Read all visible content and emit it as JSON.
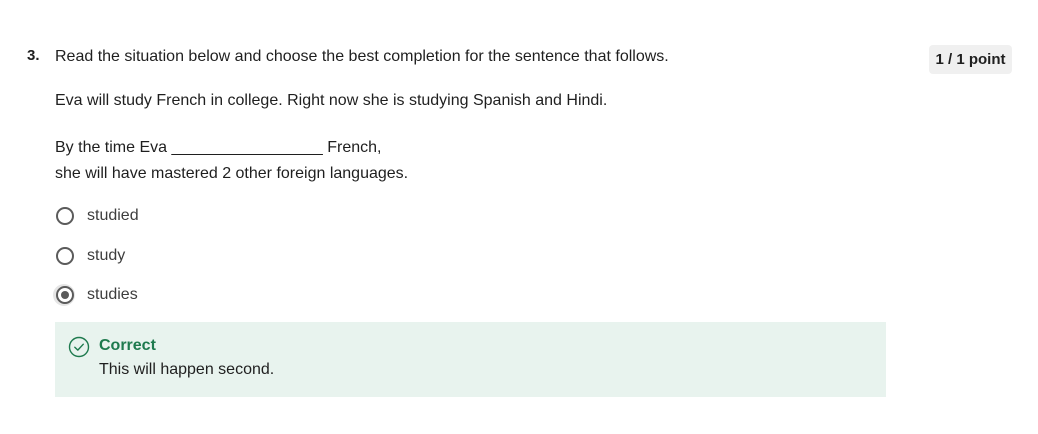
{
  "question": {
    "number": "3.",
    "prompt": "Read the situation below and choose the best completion for the sentence that follows.",
    "score": "1 / 1 point",
    "situation": "Eva will study French in college.  Right now she is studying Spanish and Hindi.",
    "sentence_line1": "By the time Eva _________________ French,",
    "sentence_line2": "she will have mastered 2 other foreign languages."
  },
  "options": [
    {
      "label": "studied",
      "selected": false
    },
    {
      "label": "study",
      "selected": false
    },
    {
      "label": "studies",
      "selected": true
    }
  ],
  "feedback": {
    "status": "Correct",
    "message": "This will happen second.",
    "icon": "check-circle-icon",
    "color": "#1e7a4e",
    "background": "#e8f3ee"
  }
}
